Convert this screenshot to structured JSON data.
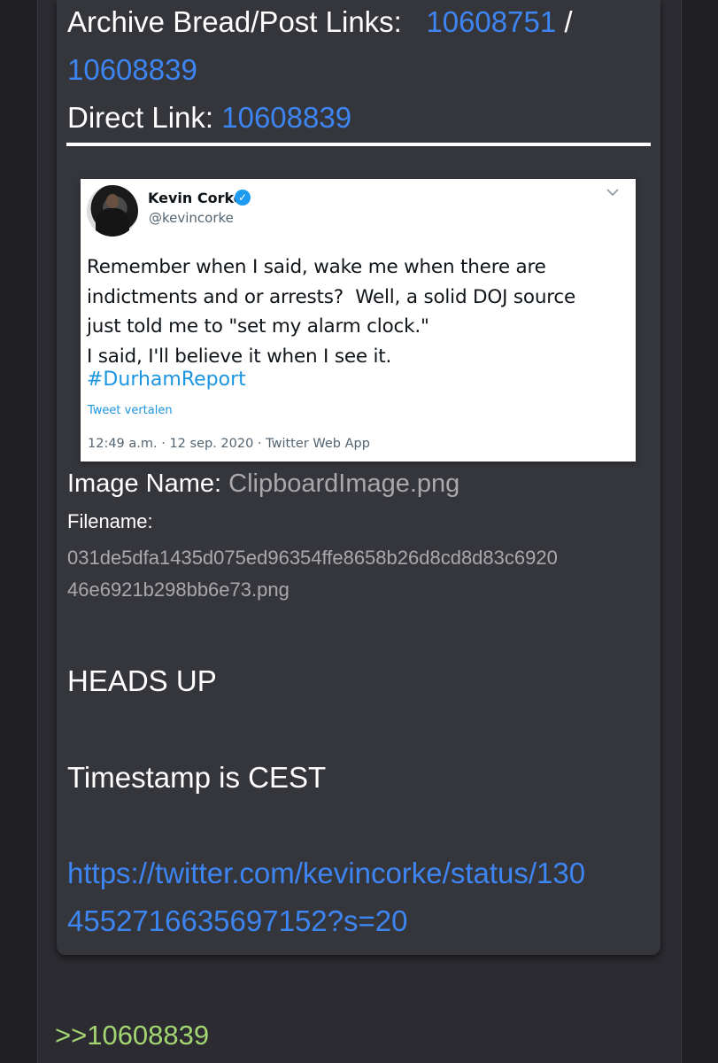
{
  "post": {
    "archive_label": "Archive Bread/Post Links:",
    "archive_link_1": "10608751",
    "archive_sep": "/",
    "archive_link_2": "10608839",
    "direct_label": "Direct Link:",
    "direct_link": "10608839",
    "image_name_label": "Image Name:",
    "image_name": "ClipboardImage.png",
    "filename_label": "Filename:",
    "filename_line1": "031de5dfa1435d075ed96354ffe8658b26d8cd8d83c6920",
    "filename_line2": "46e6921b298bb6e73.png",
    "heads_up": "HEADS UP",
    "timestamp_note": "Timestamp is CEST",
    "url_line1": "https://twitter.com/kevincorke/status/130",
    "url_line2": "4552716635697152?s=20",
    "reply_link": ">>10608839"
  },
  "tweet": {
    "author_name": "Kevin Corke",
    "handle": "@kevincorke",
    "body": "Remember when I said, wake me when there are\nindictments and or arrests?  Well, a solid DOJ source\njust told me to \"set my alarm clock.\"\nI said, I'll believe it when I see it.",
    "hashtag": "#DurhamReport",
    "translate": "Tweet vertalen",
    "meta": "12:49 a.m. · 12 sep. 2020 · Twitter Web App"
  },
  "colors": {
    "link": "#3d85f2",
    "reply_link": "#a3d571",
    "card_bg": "#35363c",
    "page_bg": "#1f1f24"
  },
  "icons": {
    "verified": "verified-badge-icon",
    "menu": "chevron-down-icon"
  }
}
